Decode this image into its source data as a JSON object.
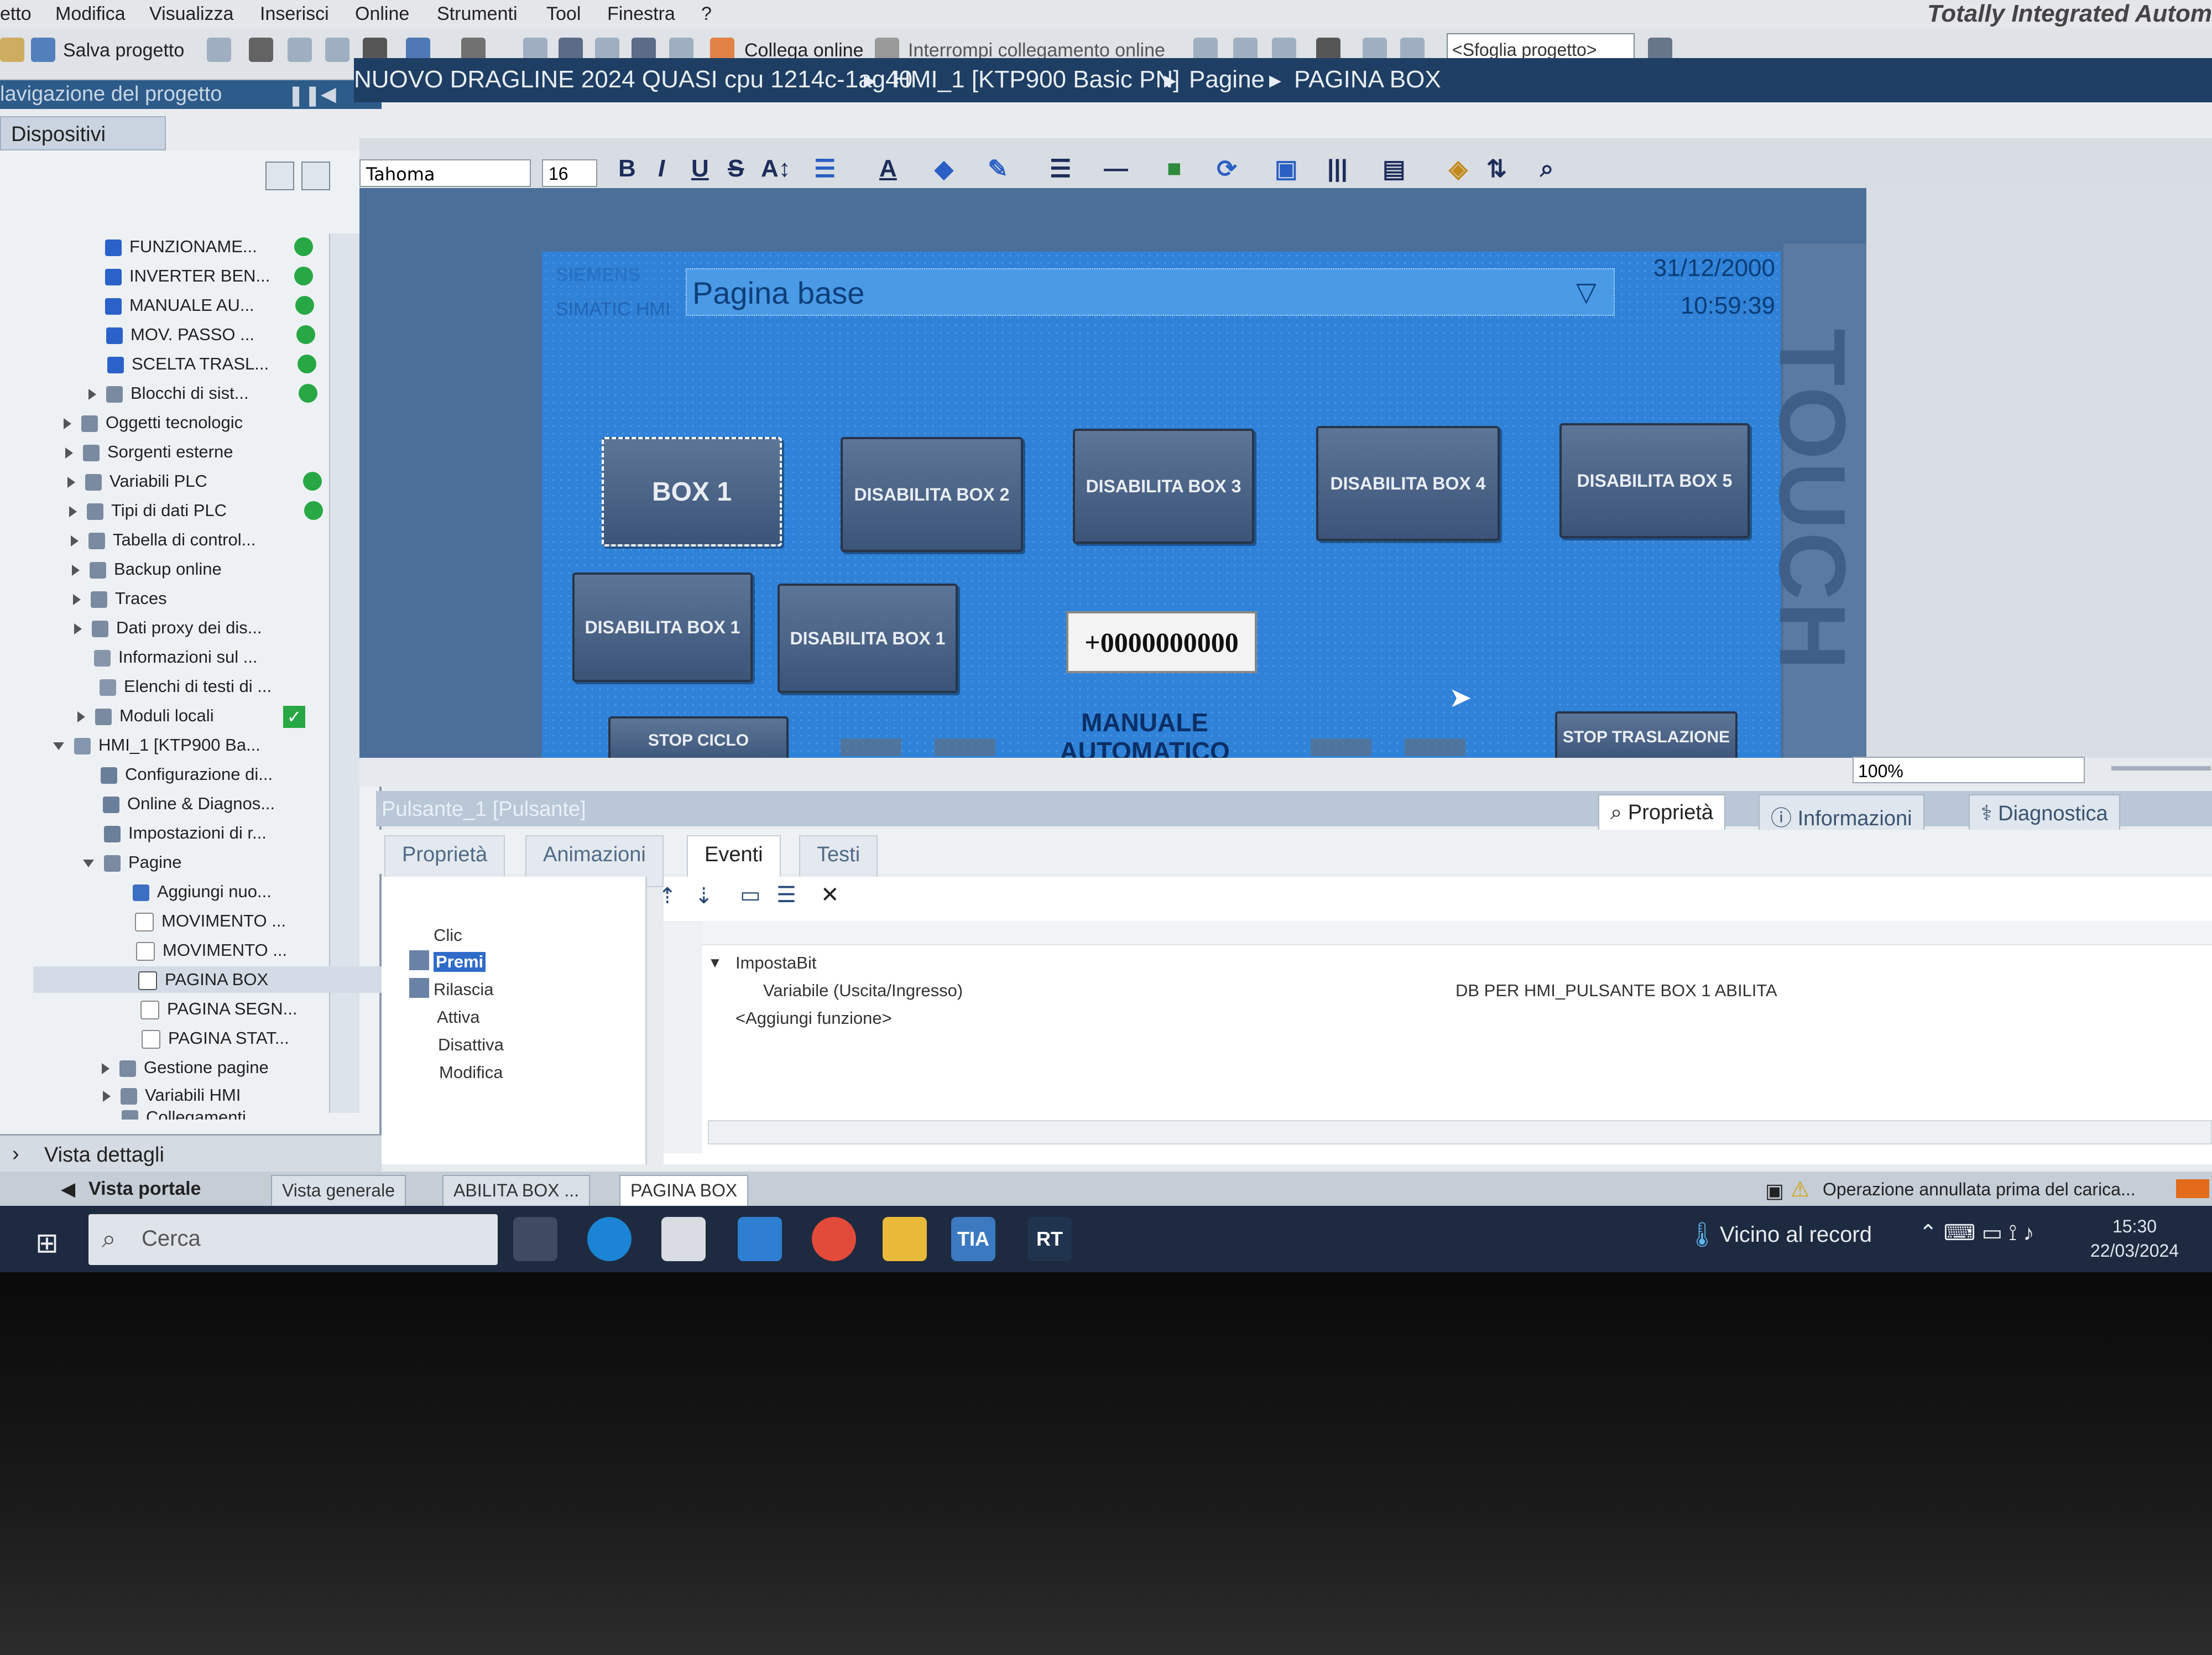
{
  "menu": [
    "etto",
    "Modifica",
    "Visualizza",
    "Inserisci",
    "Online",
    "Strumenti",
    "Tool",
    "Finestra",
    "?"
  ],
  "brand": "Totally Integrated Autom",
  "toolbar": {
    "save": "Salva progetto",
    "connect_online": "Collega online",
    "disconnect": "Interrompi collegamento online",
    "project_sheet": "<Sfoglia progetto>"
  },
  "nav": {
    "header": "lavigazione del progetto",
    "tab": "Dispositivi",
    "items": [
      {
        "label": "FUNZIONAME...",
        "status": "ok"
      },
      {
        "label": "INVERTER BEN...",
        "status": "ok"
      },
      {
        "label": "MANUALE AU...",
        "status": "ok"
      },
      {
        "label": "MOV. PASSO ...",
        "status": "ok"
      },
      {
        "label": "SCELTA TRASL...",
        "status": "ok"
      },
      {
        "label": "Blocchi di sist...",
        "status": "ok"
      },
      {
        "label": "Oggetti tecnologic",
        "status": ""
      },
      {
        "label": "Sorgenti esterne",
        "status": ""
      },
      {
        "label": "Variabili PLC",
        "status": "ok"
      },
      {
        "label": "Tipi di dati PLC",
        "status": "ok"
      },
      {
        "label": "Tabella di control...",
        "status": ""
      },
      {
        "label": "Backup online",
        "status": ""
      },
      {
        "label": "Traces",
        "status": ""
      },
      {
        "label": "Dati proxy dei dis...",
        "status": ""
      },
      {
        "label": "Informazioni sul ...",
        "status": ""
      },
      {
        "label": "Elenchi di testi di ...",
        "status": ""
      },
      {
        "label": "Moduli locali",
        "status": "check"
      },
      {
        "label": "HMI_1 [KTP900 Ba...",
        "status": ""
      },
      {
        "label": "Configurazione di...",
        "status": ""
      },
      {
        "label": "Online & Diagnos...",
        "status": ""
      },
      {
        "label": "Impostazioni di r...",
        "status": ""
      },
      {
        "label": "Pagine",
        "status": ""
      },
      {
        "label": "Aggiungi nuo...",
        "status": ""
      },
      {
        "label": "MOVIMENTO ...",
        "status": ""
      },
      {
        "label": "MOVIMENTO ...",
        "status": ""
      },
      {
        "label": "PAGINA BOX",
        "status": ""
      },
      {
        "label": "PAGINA SEGN...",
        "status": ""
      },
      {
        "label": "PAGINA STAT...",
        "status": ""
      },
      {
        "label": "Gestione pagine",
        "status": ""
      },
      {
        "label": "Variabili HMI",
        "status": ""
      },
      {
        "label": "Collegamenti",
        "status": ""
      }
    ],
    "details": "Vista dettagli"
  },
  "breadcrumb": [
    "NUOVO DRAGLINE 2024 QUASI cpu 1214c-1ag40",
    "HMI_1 [KTP900 Basic PN]",
    "Pagine",
    "PAGINA BOX"
  ],
  "format": {
    "font": "Tahoma",
    "size": "16"
  },
  "hmi": {
    "siemens": "SIEMENS",
    "simatic": "SIMATIC HMI",
    "base_title": "Pagina base",
    "date": "31/12/2000",
    "time": "10:59:39",
    "touch": "TOUCH",
    "buttons": {
      "box1": "BOX 1",
      "dis2": "DISABILITA BOX 2",
      "dis3": "DISABILITA BOX 3",
      "dis4": "DISABILITA BOX 4",
      "dis5": "DISABILITA BOX 5",
      "dis1a": "DISABILITA BOX 1",
      "dis1b": "DISABILITA BOX 1",
      "stop_ciclo": "STOP CICLO",
      "stop_trasl": "STOP TRASLAZIONE"
    },
    "number_field": "+0000000000",
    "manual_auto": "MANUALE AUTOMATICO"
  },
  "zoom": "100%",
  "properties": {
    "object": "Pulsante_1 [Pulsante]",
    "panel_tabs": [
      "Proprietà",
      "Informazioni",
      "Diagnostica"
    ],
    "subtabs": [
      "Proprietà",
      "Animazioni",
      "Eventi",
      "Testi"
    ],
    "events": [
      "Clic",
      "Premi",
      "Rilascia",
      "Attiva",
      "Disattiva",
      "Modifica"
    ],
    "function": "ImpostaBit",
    "param": "Variabile (Uscita/Ingresso)",
    "value": "DB PER HMI_PULSANTE BOX 1 ABILITA",
    "add_function": "<Aggiungi funzione>"
  },
  "statusbar": {
    "portal": "Vista portale",
    "tabs": [
      "Vista generale",
      "ABILITA BOX ...",
      "PAGINA BOX"
    ],
    "message": "Operazione annullata prima del carica..."
  },
  "taskbar": {
    "search": "Cerca",
    "weather": "Vicino al record",
    "time": "15:30",
    "date": "22/03/2024"
  },
  "colors": {
    "hmi_bg": "#2f82d8",
    "nav_header": "#2d5b8a",
    "breadcrumb": "#1f3e63",
    "status_ok": "#27a845"
  }
}
